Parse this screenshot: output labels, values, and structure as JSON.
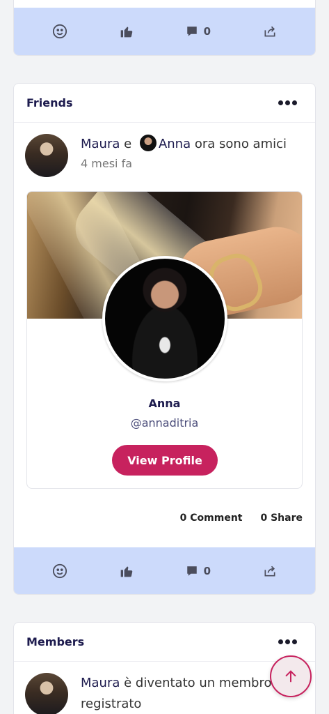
{
  "top_card": {
    "reaction_count": "0"
  },
  "friends_card": {
    "title": "Friends",
    "activity": {
      "actor": "Maura",
      "conjunction": "e",
      "friend": "Anna",
      "action_text": "ora sono amici",
      "time": "4 mesi fa"
    },
    "profile": {
      "name": "Anna",
      "handle": "@annaditria",
      "button_label": "View Profile"
    },
    "stats": {
      "comments": "0 Comment",
      "shares": "0 Share"
    },
    "reaction_count": "0"
  },
  "members_card": {
    "title": "Members",
    "activity": {
      "actor": "Maura",
      "action_text": "è diventato un membro registrato"
    }
  },
  "colors": {
    "action_bar": "#ccdafb",
    "primary_button": "#c7225e",
    "name_text": "#1d1b4e"
  },
  "icons": [
    "smiley-icon",
    "thumbs-up-icon",
    "comment-icon",
    "share-icon",
    "more-options-icon",
    "arrow-up-icon"
  ]
}
